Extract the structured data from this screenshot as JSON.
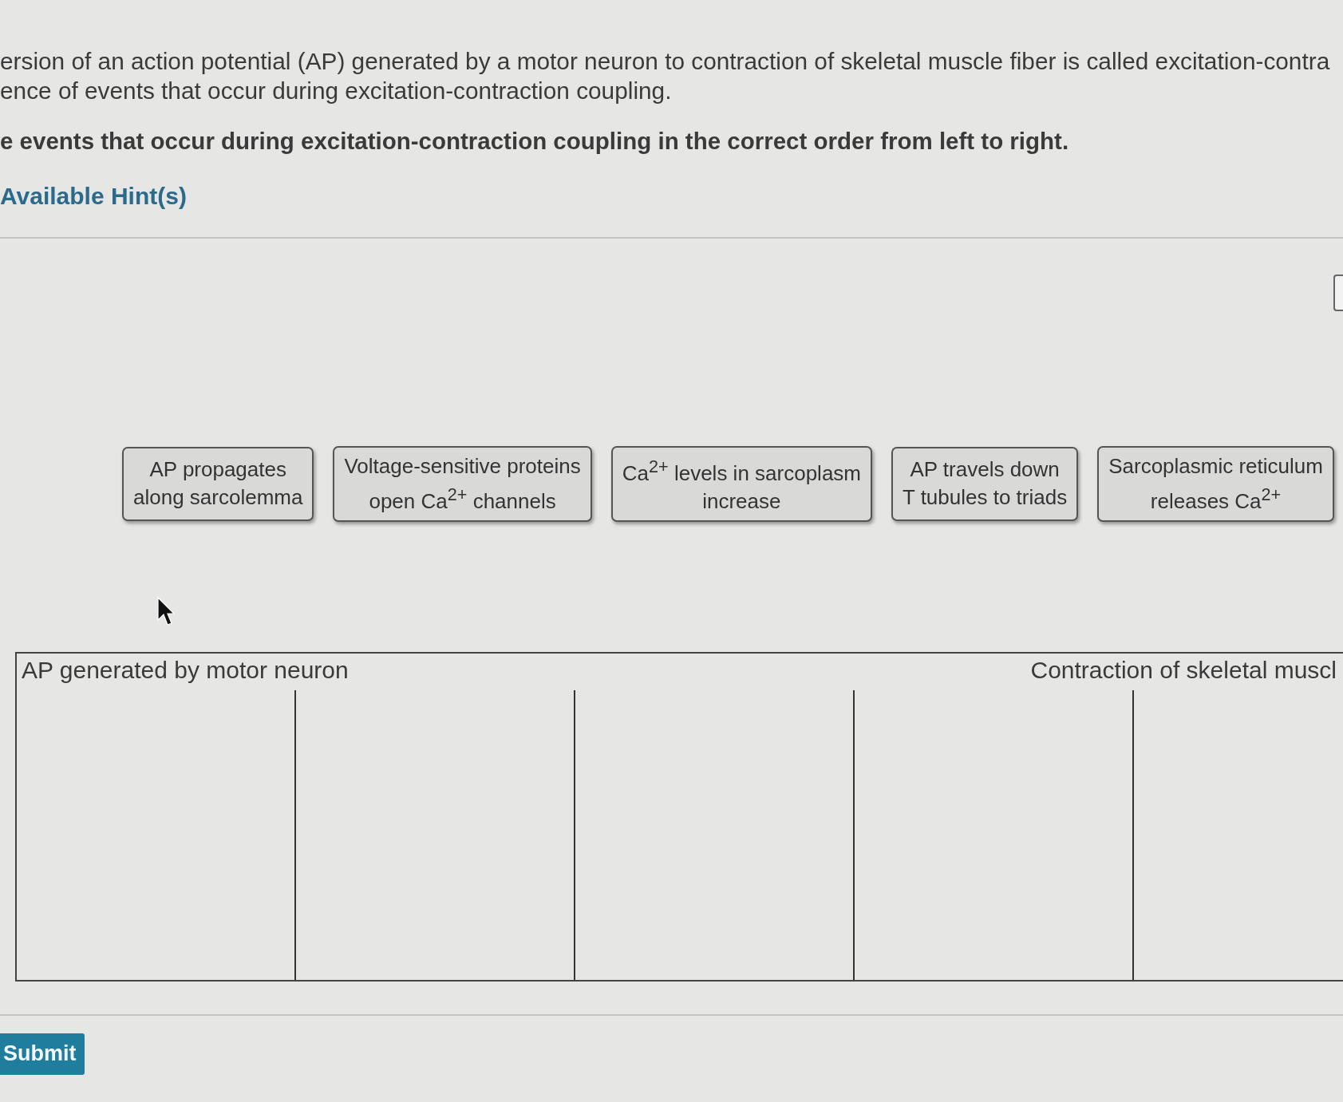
{
  "question": {
    "intro_lines": [
      "ersion of an action potential (AP) generated by a motor neuron to contraction of skeletal muscle fiber is called excitation-contra",
      "ence of events that occur during excitation-contraction coupling."
    ],
    "instruction": "e events that occur during excitation-contraction coupling in the correct order from left to right.",
    "hints_link": "Available Hint(s)"
  },
  "tiles": [
    {
      "lines": [
        "AP propagates",
        "along sarcolemma"
      ]
    },
    {
      "lines": [
        "Voltage-sensitive proteins",
        "open Ca$^{2+}$ channels"
      ]
    },
    {
      "lines": [
        "Ca$^{2+}$ levels in sarcoplasm",
        "increase"
      ]
    },
    {
      "lines": [
        "AP travels down",
        "T tubules to triads"
      ]
    },
    {
      "lines": [
        "Sarcoplasmic reticulum",
        "releases Ca$^{2+}$"
      ]
    }
  ],
  "drop_zone": {
    "start_label": "AP generated by motor neuron",
    "end_label": "Contraction of skeletal muscl",
    "slots": [
      {
        "kind": "empty"
      },
      {
        "kind": "empty"
      },
      {
        "kind": "empty"
      },
      {
        "kind": "empty"
      },
      {
        "kind": "empty"
      }
    ]
  },
  "submit_button": {
    "label": "Submit"
  }
}
